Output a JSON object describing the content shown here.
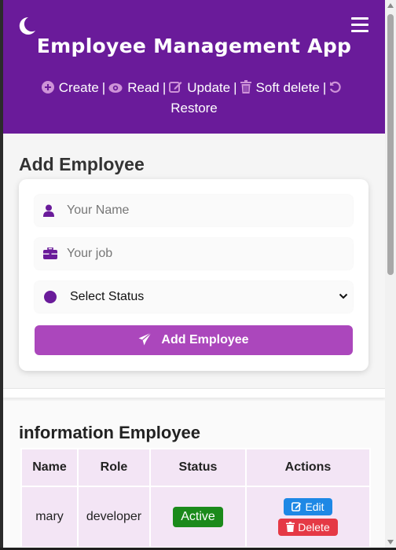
{
  "header": {
    "title": "Employee Management App",
    "crud": [
      {
        "icon": "plus-circle-icon",
        "label": "Create"
      },
      {
        "icon": "eye-icon",
        "label": "Read"
      },
      {
        "icon": "edit-icon",
        "label": "Update"
      },
      {
        "icon": "trash-icon",
        "label": "Soft delete"
      },
      {
        "icon": "undo-icon",
        "label": "Restore"
      }
    ],
    "separator": "|"
  },
  "form": {
    "title": "Add Employee",
    "name_placeholder": "Your Name",
    "job_placeholder": "Your job",
    "status_value": "Select Status",
    "submit_label": "Add Employee"
  },
  "table": {
    "title": "information Employee",
    "columns": [
      "Name",
      "Role",
      "Status",
      "Actions"
    ],
    "rows": [
      {
        "name": "mary",
        "role": "developer",
        "status": "Active",
        "edit_label": "Edit",
        "delete_label": "Delete"
      }
    ]
  },
  "colors": {
    "header_bg": "#6a1b9a",
    "accent": "#ab47bc",
    "active_badge": "#1b8a1b",
    "edit": "#1e88e5",
    "delete": "#e53945"
  }
}
